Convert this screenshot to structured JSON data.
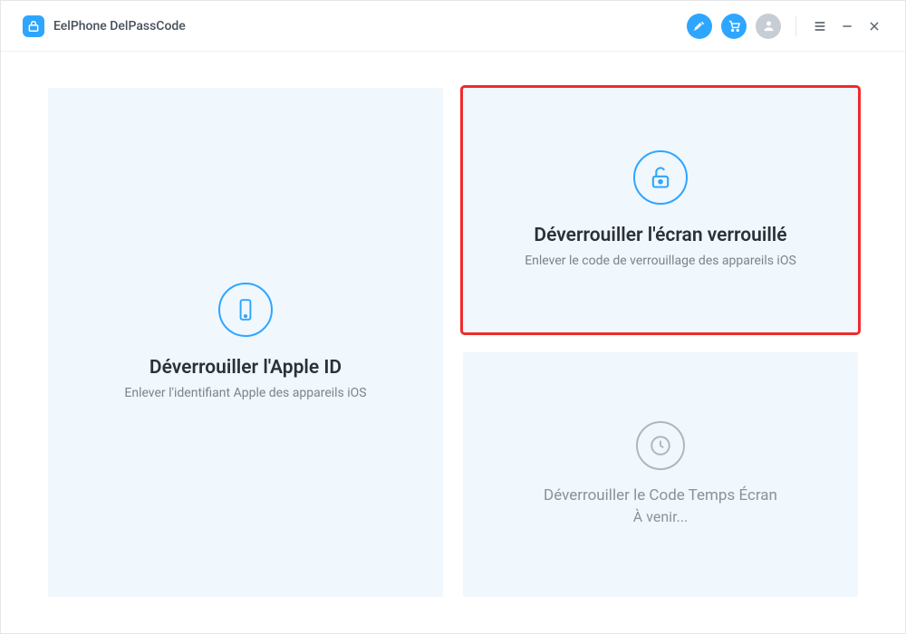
{
  "app": {
    "title": "EelPhone DelPassCode"
  },
  "cards": {
    "appleId": {
      "title": "Déverrouiller l'Apple ID",
      "sub": "Enlever l'identifiant Apple des appareils iOS"
    },
    "lockScreen": {
      "title": "Déverrouiller l'écran verrouillé",
      "sub": "Enlever le code de verrouillage des appareils iOS"
    },
    "screenTime": {
      "title": "Déverrouiller le Code Temps Écran",
      "sub": "À venir..."
    }
  }
}
